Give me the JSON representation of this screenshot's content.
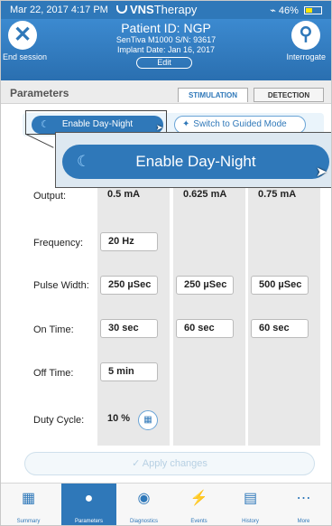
{
  "status_bar": {
    "time": "Mar 22, 2017  4:17 PM",
    "brand_prefix": "VNS",
    "brand_suffix": "Therapy",
    "battery": "46%",
    "battery_level_pct": 46
  },
  "header": {
    "patient_id": "Patient ID: NGP",
    "device": "SenTiva M1000 S/N: 93617",
    "implant": "Implant Date: Jan 16, 2017",
    "edit_label": "Edit",
    "end_session_label": "End session",
    "interrogate_label": "Interrogate"
  },
  "tabs": {
    "section_title": "Parameters",
    "stimulation": "STIMULATION",
    "detection": "DETECTION"
  },
  "mode_buttons": {
    "day_night": "Enable Day-Night",
    "guided": "Switch to Guided Mode"
  },
  "zoom": {
    "label": "Enable Day-Night"
  },
  "params": {
    "output": {
      "label": "Output:",
      "values": [
        "0.5 mA",
        "0.625 mA",
        "0.75 mA"
      ]
    },
    "frequency": {
      "label": "Frequency:",
      "values": [
        "20 Hz"
      ]
    },
    "pulse_width": {
      "label": "Pulse Width:",
      "values": [
        "250 µSec",
        "250 µSec",
        "500 µSec"
      ]
    },
    "on_time": {
      "label": "On Time:",
      "values": [
        "30 sec",
        "60 sec",
        "60 sec"
      ]
    },
    "off_time": {
      "label": "Off Time:",
      "values": [
        "5 min"
      ]
    },
    "duty_cycle": {
      "label": "Duty Cycle:",
      "value": "10 %"
    }
  },
  "apply_label": "Apply changes",
  "nav": [
    "Summary",
    "Parameters",
    "Diagnostics",
    "Events",
    "History",
    "More"
  ],
  "colors": {
    "accent": "#2f78b9",
    "battery": "#ffe600"
  }
}
